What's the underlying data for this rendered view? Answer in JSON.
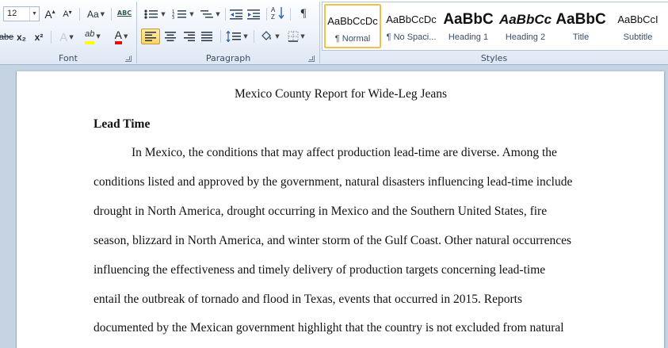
{
  "ribbon": {
    "font_group": {
      "label": "Font",
      "font_size": "12",
      "grow_font": "A",
      "shrink_font": "A",
      "change_case": "Aa",
      "clear_formatting": "ABC",
      "strikethrough": "abe",
      "subscript": "x₂",
      "superscript": "x²",
      "text_effects": "A",
      "highlight": "ab",
      "font_color": "A",
      "highlight_color": "#ffff00",
      "font_color_value": "#ff0000"
    },
    "paragraph_group": {
      "label": "Paragraph",
      "pilcrow": "¶"
    },
    "styles_group": {
      "label": "Styles",
      "styles": [
        {
          "sample": "AaBbCcDc",
          "name": "¶ Normal"
        },
        {
          "sample": "AaBbCcDc",
          "name": "¶ No Spaci..."
        },
        {
          "sample": "AaBbC",
          "name": "Heading 1"
        },
        {
          "sample": "AaBbCc",
          "name": "Heading 2"
        },
        {
          "sample": "AaBbC",
          "name": "Title"
        },
        {
          "sample": "AaBbCcI",
          "name": "Subtitle"
        }
      ]
    }
  },
  "document": {
    "title": "Mexico County Report for Wide-Leg Jeans",
    "heading": "Lead Time",
    "lines": [
      "In Mexico, the conditions that may affect production lead-time are diverse. Among the",
      "conditions listed and approved by the government, natural disasters influencing lead-time include",
      "drought in North America, drought occurring in Mexico and the Southern United States, fire",
      "season, blizzard in North America, and winter storm of the Gulf Coast. Other natural occurrences",
      "influencing the effectiveness and timely delivery of production targets concerning lead-time",
      "entail the outbreak of tornado and flood in Texas, events that occurred in 2015.  Reports",
      "documented by the Mexican government highlight that the country is not excluded from natural"
    ]
  }
}
